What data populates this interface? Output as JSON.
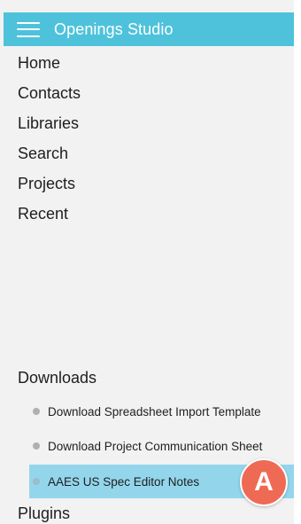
{
  "header": {
    "title": "Openings Studio",
    "menu_icon": "hamburger-menu-icon",
    "background_color": "#4ec2db"
  },
  "nav": {
    "items": [
      {
        "label": "Home"
      },
      {
        "label": "Contacts"
      },
      {
        "label": "Libraries"
      },
      {
        "label": "Search"
      },
      {
        "label": "Projects"
      },
      {
        "label": "Recent"
      }
    ]
  },
  "downloads": {
    "title": "Downloads",
    "items": [
      {
        "label": "Download Spreadsheet Import Template"
      },
      {
        "label": "Download Project Communication Sheet"
      },
      {
        "label": "AAES US Spec Editor Notes",
        "selected": true
      }
    ],
    "selected_color": "#93d6ec"
  },
  "plugins": {
    "title": "Plugins"
  },
  "annotation": {
    "label": "A",
    "color": "#ef6a54"
  }
}
